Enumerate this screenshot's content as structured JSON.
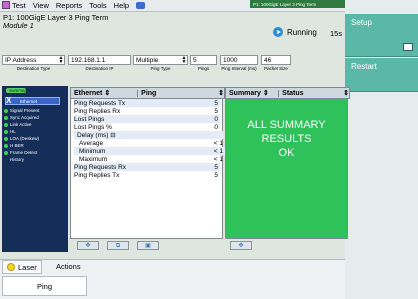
{
  "menubar": {
    "items": [
      "Test",
      "View",
      "Reports",
      "Tools",
      "Help"
    ],
    "test_status": "P1: 100GigE Layer 3 Ping Term"
  },
  "header": {
    "title": "P1: 100GigE Layer 3 Ping Term",
    "subtitle": "Module 1",
    "status": "Running",
    "elapsed": "15s"
  },
  "side_buttons": {
    "setup": "Setup",
    "restart": "Restart"
  },
  "controls": {
    "ip_type": {
      "value": "IP Address",
      "label": "Destination Type"
    },
    "dest_ip": {
      "value": "192.168.1.1",
      "label": "Destination IP"
    },
    "ping_type": {
      "value": "Multiple",
      "label": "Ping Type"
    },
    "pings": {
      "value": "5",
      "label": "Pings"
    },
    "interval": {
      "value": "1000",
      "label": "Ping Interval (ms)"
    },
    "packet_size": {
      "value": "46",
      "label": "Packet Size"
    }
  },
  "nav": {
    "items": [
      "Summary",
      "Ethernet",
      "Signal Present",
      "Sync Acquired",
      "Link Active",
      "HL",
      "LOA (Deskew)",
      "H BER",
      "Frame Detect",
      "History"
    ]
  },
  "left_pane": {
    "category": "Ethernet",
    "group": "Ping",
    "rows": [
      {
        "label": "Ping Requests Tx",
        "value": "5"
      },
      {
        "label": "Ping Replies Rx",
        "value": "5"
      },
      {
        "label": "Lost Pings",
        "value": "0"
      },
      {
        "label": "Lost Pings %",
        "value": "0"
      },
      {
        "label": "Delay (ms) ⊟",
        "value": ""
      },
      {
        "label": "Average",
        "value": "< 1"
      },
      {
        "label": "Minimum",
        "value": "< 1"
      },
      {
        "label": "Maximum",
        "value": "< 1"
      },
      {
        "label": "Ping Requests Rx",
        "value": "5"
      },
      {
        "label": "Ping Replies Tx",
        "value": "5"
      }
    ]
  },
  "right_pane": {
    "category": "Summary",
    "group": "Status",
    "message_lines": [
      "ALL SUMMARY",
      "RESULTS",
      "OK"
    ]
  },
  "bottom": {
    "tabs": [
      "Laser",
      "Actions"
    ],
    "action_button": "Ping"
  },
  "colors": {
    "summary_ok_bg": "#2fc25a",
    "nav_bg": "#142d59",
    "button_teal": "#5bb8a8"
  }
}
